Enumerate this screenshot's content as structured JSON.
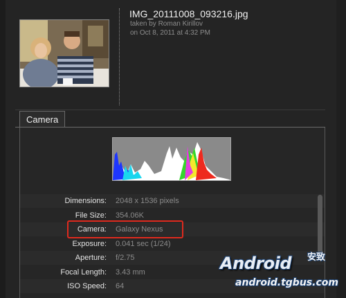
{
  "photo": {
    "filename": "IMG_20111008_093216.jpg",
    "taken_by": "taken by Roman Kirillov",
    "taken_on": "on Oct 8, 2011 at 4:32 PM"
  },
  "tabs": [
    {
      "label": "Camera",
      "selected": true
    }
  ],
  "exif": [
    {
      "label": "Dimensions:",
      "value": "2048 x 1536 pixels"
    },
    {
      "label": "File Size:",
      "value": "354.06K"
    },
    {
      "label": "Camera:",
      "value": "Galaxy Nexus"
    },
    {
      "label": "Exposure:",
      "value": "0.041 sec (1/24)"
    },
    {
      "label": "Aperture:",
      "value": "f/2.75"
    },
    {
      "label": "Focal Length:",
      "value": "3.43 mm"
    },
    {
      "label": "ISO Speed:",
      "value": "64"
    }
  ],
  "annotation": {
    "highlighted_row": "Camera:",
    "color": "#e02a1e"
  },
  "watermark": {
    "brand": "Android",
    "cn": "安致",
    "url": "android.tgbus.com"
  },
  "colors": {
    "background": "#242424",
    "label_text": "#e4e4e4",
    "value_text": "#8c8c8c",
    "highlight": "#e02a1e"
  }
}
